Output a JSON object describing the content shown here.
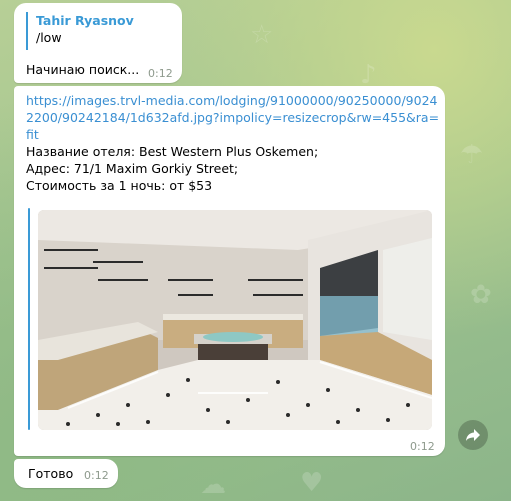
{
  "messages": {
    "low": {
      "reply_author": "Tahir Ryasnov",
      "reply_text": "/low",
      "text": "Начинаю поиск...",
      "time": "0:12"
    },
    "hotel": {
      "link": "https://images.trvl-media.com/lodging/91000000/90250000/90242200/90242184/1d632afd.jpg?impolicy=resizecrop&rw=455&ra=fit",
      "name_line": "Название отеля: Best Western Plus Oskemen;",
      "address_line": "Адрес: 71/1 Maxim Gorkiy Street;",
      "price_line": "Стоимость за 1 ночь: от $53",
      "time": "0:12"
    },
    "done": {
      "text": "Готово",
      "time": "0:12"
    }
  },
  "icons": {
    "share": "forward-arrow-icon"
  },
  "colors": {
    "accent": "#3a9ad6",
    "link": "#3a8fd2",
    "bubble": "#ffffff"
  }
}
